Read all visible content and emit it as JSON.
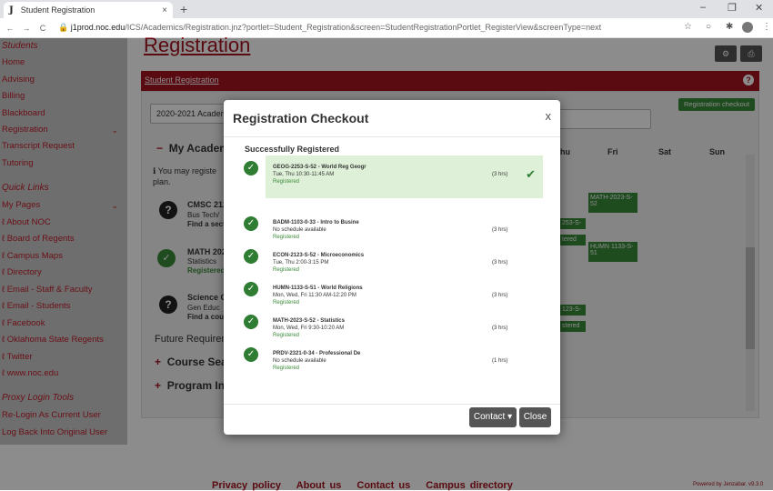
{
  "browser": {
    "tab_title": "Student Registration",
    "favicon": "J",
    "tab_close": "×",
    "new_tab": "+",
    "min": "–",
    "max": "❐",
    "close": "✕",
    "back": "←",
    "forward": "→",
    "reload": "C",
    "lock": "🔒",
    "url_host": "j1prod.noc.edu",
    "url_path": "/ICS/Academics/Registration.jnz?portlet=Student_Registration&screen=StudentRegistrationPortlet_RegisterView&screenType=next",
    "star": "☆",
    "more": "⋮"
  },
  "sidebar": {
    "items": [
      "Students",
      "Home",
      "Advising",
      "Billing",
      "Blackboard",
      "Registration",
      "Transcript Request",
      "Tutoring"
    ],
    "quick_links_heading": "Quick Links",
    "links": [
      "My Pages",
      "About NOC",
      "Board of Regents",
      "Campus Maps",
      "Directory",
      "Email - Staff & Faculty",
      "Email - Students",
      "Facebook",
      "Oklahoma State Regents",
      "Twitter",
      "www.noc.edu"
    ],
    "proxy_heading": "Proxy Login Tools",
    "proxy_items": [
      "Re-Login As Current User",
      "Log Back Into Original User"
    ]
  },
  "page": {
    "title": "Registration",
    "breadcrumb": "Student Registration",
    "term": "2020-2021 Acader",
    "registration_checkout": "Registration checkout",
    "my_academic": "My Academ",
    "you_may": "You may registe",
    "plan": "plan.",
    "days": [
      "hu",
      "Fri",
      "Sat",
      "Sun"
    ],
    "future": "Future Requirem",
    "course_search": "Course Sear",
    "program": "Program In",
    "bg_courses": [
      {
        "code": "CMSC 212",
        "sub": "Bus Tech/",
        "find": "Find a secti"
      },
      {
        "code": "MATH 202",
        "sub": "Statistics",
        "find": "Registered"
      },
      {
        "code": "Science Ge",
        "sub": "Gen Educ",
        "find": "Find a cour"
      }
    ],
    "cal_blocks": [
      "MATH-2023-S-52",
      "253-S-",
      "tered",
      "HUMN 1133-S-51",
      "123-S-",
      "stered"
    ]
  },
  "modal": {
    "title": "Registration Checkout",
    "close": "x",
    "success_heading": "Successfully Registered",
    "courses": [
      {
        "name": "GEOG-2253-S-52 - World Reg Geogr",
        "sched": "Tue, Thu 10:30-11:45 AM",
        "status": "Registered",
        "hrs": "(3 hrs)"
      },
      {
        "name": "BADM-1103-0-33 - Intro to Busine",
        "sched": "No schedule available",
        "status": "Registered",
        "hrs": "(3 hrs)"
      },
      {
        "name": "ECON-2123-S-52 - Microeconomics",
        "sched": "Tue, Thu 2:00-3:15 PM",
        "status": "Registered",
        "hrs": "(3 hrs)"
      },
      {
        "name": "HUMN-1133-S-51 - World Religions",
        "sched": "Mon, Wed, Fri 11:30 AM-12:20 PM",
        "status": "Registered",
        "hrs": "(3 hrs)"
      },
      {
        "name": "MATH-2023-S-52 - Statistics",
        "sched": "Mon, Wed, Fri 9:30-10:20 AM",
        "status": "Registered",
        "hrs": "(3 hrs)"
      },
      {
        "name": "PRDV-2321-0-34 - Professional De",
        "sched": "No schedule available",
        "status": "Registered",
        "hrs": "(1 hrs)"
      }
    ],
    "contact": "Contact ▾",
    "close_btn": "Close"
  },
  "footer": {
    "links": [
      "Privacy policy",
      "About us",
      "Contact us",
      "Campus directory"
    ],
    "powered": "Powered by Jenzabar. v9.3.0"
  }
}
